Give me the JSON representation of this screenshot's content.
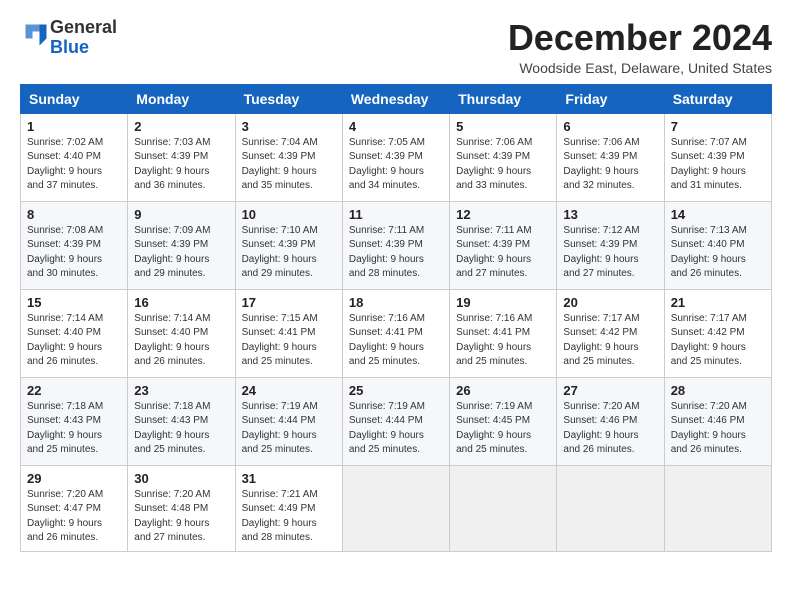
{
  "header": {
    "logo_general": "General",
    "logo_blue": "Blue",
    "month_title": "December 2024",
    "location": "Woodside East, Delaware, United States"
  },
  "days_of_week": [
    "Sunday",
    "Monday",
    "Tuesday",
    "Wednesday",
    "Thursday",
    "Friday",
    "Saturday"
  ],
  "weeks": [
    [
      {
        "day": "1",
        "info": "Sunrise: 7:02 AM\nSunset: 4:40 PM\nDaylight: 9 hours\nand 37 minutes."
      },
      {
        "day": "2",
        "info": "Sunrise: 7:03 AM\nSunset: 4:39 PM\nDaylight: 9 hours\nand 36 minutes."
      },
      {
        "day": "3",
        "info": "Sunrise: 7:04 AM\nSunset: 4:39 PM\nDaylight: 9 hours\nand 35 minutes."
      },
      {
        "day": "4",
        "info": "Sunrise: 7:05 AM\nSunset: 4:39 PM\nDaylight: 9 hours\nand 34 minutes."
      },
      {
        "day": "5",
        "info": "Sunrise: 7:06 AM\nSunset: 4:39 PM\nDaylight: 9 hours\nand 33 minutes."
      },
      {
        "day": "6",
        "info": "Sunrise: 7:06 AM\nSunset: 4:39 PM\nDaylight: 9 hours\nand 32 minutes."
      },
      {
        "day": "7",
        "info": "Sunrise: 7:07 AM\nSunset: 4:39 PM\nDaylight: 9 hours\nand 31 minutes."
      }
    ],
    [
      {
        "day": "8",
        "info": "Sunrise: 7:08 AM\nSunset: 4:39 PM\nDaylight: 9 hours\nand 30 minutes."
      },
      {
        "day": "9",
        "info": "Sunrise: 7:09 AM\nSunset: 4:39 PM\nDaylight: 9 hours\nand 29 minutes."
      },
      {
        "day": "10",
        "info": "Sunrise: 7:10 AM\nSunset: 4:39 PM\nDaylight: 9 hours\nand 29 minutes."
      },
      {
        "day": "11",
        "info": "Sunrise: 7:11 AM\nSunset: 4:39 PM\nDaylight: 9 hours\nand 28 minutes."
      },
      {
        "day": "12",
        "info": "Sunrise: 7:11 AM\nSunset: 4:39 PM\nDaylight: 9 hours\nand 27 minutes."
      },
      {
        "day": "13",
        "info": "Sunrise: 7:12 AM\nSunset: 4:39 PM\nDaylight: 9 hours\nand 27 minutes."
      },
      {
        "day": "14",
        "info": "Sunrise: 7:13 AM\nSunset: 4:40 PM\nDaylight: 9 hours\nand 26 minutes."
      }
    ],
    [
      {
        "day": "15",
        "info": "Sunrise: 7:14 AM\nSunset: 4:40 PM\nDaylight: 9 hours\nand 26 minutes."
      },
      {
        "day": "16",
        "info": "Sunrise: 7:14 AM\nSunset: 4:40 PM\nDaylight: 9 hours\nand 26 minutes."
      },
      {
        "day": "17",
        "info": "Sunrise: 7:15 AM\nSunset: 4:41 PM\nDaylight: 9 hours\nand 25 minutes."
      },
      {
        "day": "18",
        "info": "Sunrise: 7:16 AM\nSunset: 4:41 PM\nDaylight: 9 hours\nand 25 minutes."
      },
      {
        "day": "19",
        "info": "Sunrise: 7:16 AM\nSunset: 4:41 PM\nDaylight: 9 hours\nand 25 minutes."
      },
      {
        "day": "20",
        "info": "Sunrise: 7:17 AM\nSunset: 4:42 PM\nDaylight: 9 hours\nand 25 minutes."
      },
      {
        "day": "21",
        "info": "Sunrise: 7:17 AM\nSunset: 4:42 PM\nDaylight: 9 hours\nand 25 minutes."
      }
    ],
    [
      {
        "day": "22",
        "info": "Sunrise: 7:18 AM\nSunset: 4:43 PM\nDaylight: 9 hours\nand 25 minutes."
      },
      {
        "day": "23",
        "info": "Sunrise: 7:18 AM\nSunset: 4:43 PM\nDaylight: 9 hours\nand 25 minutes."
      },
      {
        "day": "24",
        "info": "Sunrise: 7:19 AM\nSunset: 4:44 PM\nDaylight: 9 hours\nand 25 minutes."
      },
      {
        "day": "25",
        "info": "Sunrise: 7:19 AM\nSunset: 4:44 PM\nDaylight: 9 hours\nand 25 minutes."
      },
      {
        "day": "26",
        "info": "Sunrise: 7:19 AM\nSunset: 4:45 PM\nDaylight: 9 hours\nand 25 minutes."
      },
      {
        "day": "27",
        "info": "Sunrise: 7:20 AM\nSunset: 4:46 PM\nDaylight: 9 hours\nand 26 minutes."
      },
      {
        "day": "28",
        "info": "Sunrise: 7:20 AM\nSunset: 4:46 PM\nDaylight: 9 hours\nand 26 minutes."
      }
    ],
    [
      {
        "day": "29",
        "info": "Sunrise: 7:20 AM\nSunset: 4:47 PM\nDaylight: 9 hours\nand 26 minutes."
      },
      {
        "day": "30",
        "info": "Sunrise: 7:20 AM\nSunset: 4:48 PM\nDaylight: 9 hours\nand 27 minutes."
      },
      {
        "day": "31",
        "info": "Sunrise: 7:21 AM\nSunset: 4:49 PM\nDaylight: 9 hours\nand 28 minutes."
      },
      {
        "day": "",
        "info": ""
      },
      {
        "day": "",
        "info": ""
      },
      {
        "day": "",
        "info": ""
      },
      {
        "day": "",
        "info": ""
      }
    ]
  ]
}
